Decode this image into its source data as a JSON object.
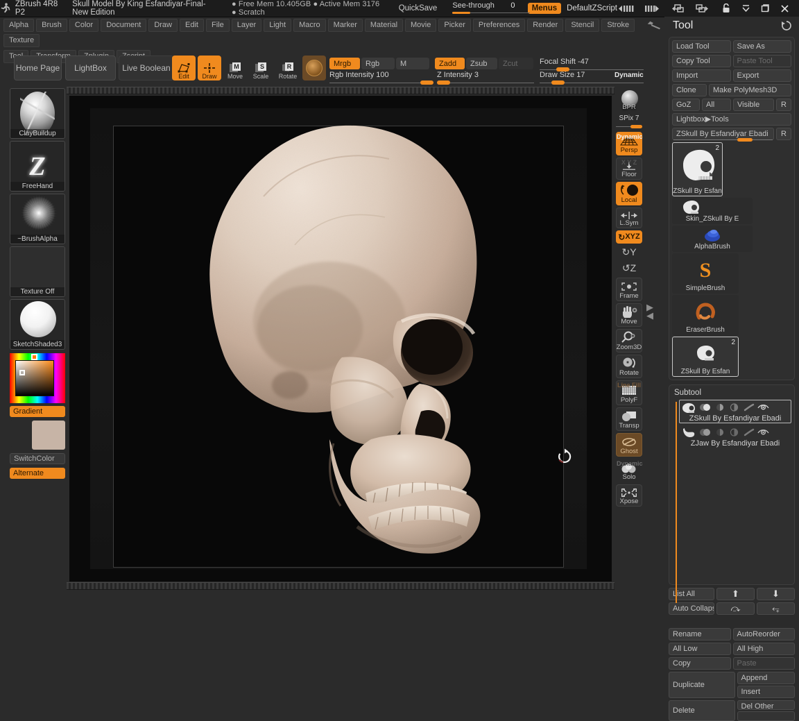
{
  "titlebar": {
    "logo_icon": "zbrush-runner-icon",
    "app": "ZBrush 4R8 P2",
    "document": "Skull Model By King Esfandiyar-Final-New Edition",
    "memory": "● Free Mem 10.405GB ● Active Mem 3176 ● Scratch",
    "quicksave": "QuickSave",
    "see_through_label": "See-through",
    "see_through_value": "0",
    "menus": "Menus",
    "zscript": "DefaultZScript",
    "icons": [
      "tray-left-icon",
      "tray-right-icon",
      "dock-left-icon",
      "dock-right-icon",
      "lock-icon",
      "minimize-icon",
      "restore-icon",
      "close-icon"
    ]
  },
  "menubar": {
    "row1": [
      "Alpha",
      "Brush",
      "Color",
      "Document",
      "Draw",
      "Edit",
      "File",
      "Layer",
      "Light",
      "Macro",
      "Marker",
      "Material",
      "Movie",
      "Picker",
      "Preferences",
      "Render",
      "Stencil",
      "Stroke",
      "Texture"
    ],
    "row2": [
      "Tool",
      "Transform",
      "Zplugin",
      "Zscript"
    ]
  },
  "shelf": {
    "home_page": "Home Page",
    "lightbox": "LightBox",
    "live_boolean": "Live Boolean",
    "edit": "Edit",
    "draw": "Draw",
    "move": "Move",
    "scale": "Scale",
    "rotate": "Rotate",
    "move_key": "M",
    "scale_key": "S",
    "rotate_key": "R",
    "mrgb": "Mrgb",
    "rgb": "Rgb",
    "m": "M",
    "zadd": "Zadd",
    "zsub": "Zsub",
    "zcut": "Zcut",
    "rgb_intensity_label": "Rgb Intensity",
    "rgb_intensity_value": "100",
    "z_intensity_label": "Z Intensity",
    "z_intensity_value": "3",
    "focal_shift_label": "Focal Shift",
    "focal_shift_value": "-47",
    "draw_size_label": "Draw Size",
    "draw_size_value": "17",
    "dynamic": "Dynamic"
  },
  "left_palette": {
    "brush": "ClayBuildup",
    "stroke": "FreeHand",
    "alpha": "~BrushAlpha",
    "texture": "Texture Off",
    "material": "SketchShaded3",
    "gradient": "Gradient",
    "switch_color": "SwitchColor",
    "alternate": "Alternate"
  },
  "vertical_toolbar": [
    {
      "name": "bpr",
      "label": "BPR",
      "icon": "sphere-icon",
      "state": "plain"
    },
    {
      "name": "spix",
      "label": "SPix",
      "value": "7",
      "type": "slider"
    },
    {
      "name": "persp",
      "label": "Persp",
      "over": "Dynamic",
      "icon": "grid-perspective-icon",
      "state": "on"
    },
    {
      "name": "floor",
      "label": "Floor",
      "over": "X Y Z",
      "icon": "floor-arrow-icon",
      "state": "off"
    },
    {
      "name": "local",
      "label": "Local",
      "icon": "local-pivot-icon",
      "state": "on"
    },
    {
      "name": "lsym",
      "label": "L.Sym",
      "icon": "symmetry-arrows-icon",
      "state": "off"
    },
    {
      "name": "xyz",
      "label": "XYZ",
      "icon": "rotate-xyz-icon",
      "state": "on"
    },
    {
      "name": "y-rot",
      "label": "",
      "icon": "rotate-y-icon",
      "state": "plain"
    },
    {
      "name": "z-rot",
      "label": "",
      "icon": "rotate-z-icon",
      "state": "plain"
    },
    {
      "name": "frame",
      "label": "Frame",
      "icon": "frame-icon",
      "state": "off"
    },
    {
      "name": "move",
      "label": "Move",
      "icon": "hand-move-icon",
      "state": "off"
    },
    {
      "name": "zoom3d",
      "label": "Zoom3D",
      "icon": "magnifier-icon",
      "state": "off"
    },
    {
      "name": "rotate",
      "label": "Rotate",
      "icon": "rotate-sphere-icon",
      "state": "off"
    },
    {
      "name": "polyf",
      "label": "PolyF",
      "over": "Line Fill",
      "icon": "polyframe-grid-icon",
      "state": "off"
    },
    {
      "name": "transp",
      "label": "Transp",
      "icon": "transparency-icon",
      "state": "off"
    },
    {
      "name": "ghost",
      "label": "Ghost",
      "icon": "ghost-icon",
      "state": "brown"
    },
    {
      "name": "solo",
      "label": "Solo",
      "over": "Dynamic",
      "icon": "solo-spheres-icon",
      "state": "off"
    },
    {
      "name": "xpose",
      "label": "Xpose",
      "icon": "xpose-arrows-icon",
      "state": "off"
    }
  ],
  "right_panel": {
    "title": "Tool",
    "reset_icon": "reset-history-icon",
    "buttons": {
      "load_tool": "Load Tool",
      "save_as": "Save As",
      "copy_tool": "Copy Tool",
      "paste_tool": "Paste Tool",
      "import": "Import",
      "export": "Export",
      "clone": "Clone",
      "make_polymesh3d": "Make PolyMesh3D",
      "goz": "GoZ",
      "all": "All",
      "visible": "Visible",
      "r": "R",
      "lightbox_tools": "Lightbox▶Tools",
      "current_tool": "ZSkull By Esfandiyar Ebadi",
      "current_tool_r": "R"
    },
    "tool_tiles": [
      {
        "name": "zskull-main",
        "label": "ZSkull By Esfan",
        "badge": "2",
        "icon": "skull-icon",
        "selected": true
      },
      {
        "name": "skin-zskull",
        "label": "Skin_ZSkull By E",
        "badge": "",
        "icon": "skull-small-icon",
        "selected": false
      },
      {
        "name": "alphabrush",
        "label": "AlphaBrush",
        "badge": "",
        "icon": "blue-blob-icon",
        "selected": false
      },
      {
        "name": "simplebrush",
        "label": "SimpleBrush",
        "badge": "",
        "icon": "orange-s-icon",
        "selected": false
      },
      {
        "name": "eraserbrush",
        "label": "EraserBrush",
        "badge": "",
        "icon": "orange-hook-icon",
        "selected": false
      },
      {
        "name": "zskull-dup",
        "label": "ZSkull By Esfan",
        "badge": "2",
        "icon": "skull-small-icon",
        "selected": true
      }
    ],
    "subtool": {
      "title": "Subtool",
      "items": [
        {
          "name": "zskull-subtool",
          "label": "ZSkull By Esfandiyar Ebadi",
          "icon": "skull-icon",
          "selected": true
        },
        {
          "name": "zjaw-subtool",
          "label": "ZJaw By Esfandiyar Ebadi",
          "icon": "jaw-icon",
          "selected": false
        }
      ],
      "row_icons": [
        "visibility-toggle-icon",
        "smooth-toggle-icon",
        "polypaint-toggle-icon",
        "brush-toggle-icon",
        "eye-toggle-icon"
      ],
      "list_all": "List All",
      "auto_collapse": "Auto Collapse",
      "move_up_icon": "arrow-up-icon",
      "move_down_icon": "arrow-down-icon",
      "indent_icon": "arrow-right-curve-icon",
      "outdent_icon": "arrow-down-right-icon",
      "rename": "Rename",
      "auto_reorder": "AutoReorder",
      "all_low": "All Low",
      "all_high": "All High",
      "copy": "Copy",
      "paste": "Paste",
      "duplicate": "Duplicate",
      "append": "Append",
      "insert": "Insert",
      "delete": "Delete",
      "del_other": "Del Other"
    }
  },
  "canvas": {
    "model_name": "skull-3d-model",
    "rotate_indicator_icon": "rotate-cw-icon",
    "scroll_up_icon": "triangle-up-icon",
    "scroll_down_icon": "triangle-down-icon"
  },
  "colors": {
    "accent": "#f08a1e",
    "panel": "#2b2b2b",
    "button": "#3a3a3a",
    "bone": "#cbb6a5"
  }
}
